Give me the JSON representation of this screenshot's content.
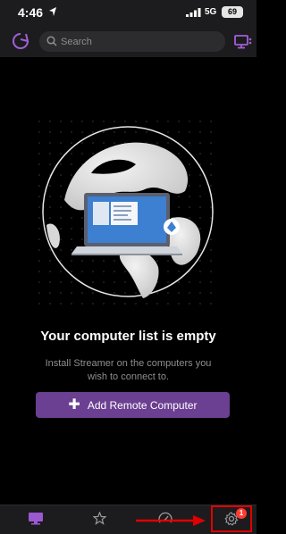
{
  "status_bar": {
    "time": "4:46",
    "network": "5G",
    "battery": "69"
  },
  "top_bar": {
    "search_placeholder": "Search"
  },
  "empty_state": {
    "title": "Your computer list is empty",
    "description": "Install Streamer on the computers you wish to connect to.",
    "add_button_label": "Add Remote Computer"
  },
  "tab_bar": {
    "settings_badge": "1"
  },
  "colors": {
    "accent": "#9b59d0",
    "button": "#6b3f91",
    "highlight": "#e00000"
  }
}
